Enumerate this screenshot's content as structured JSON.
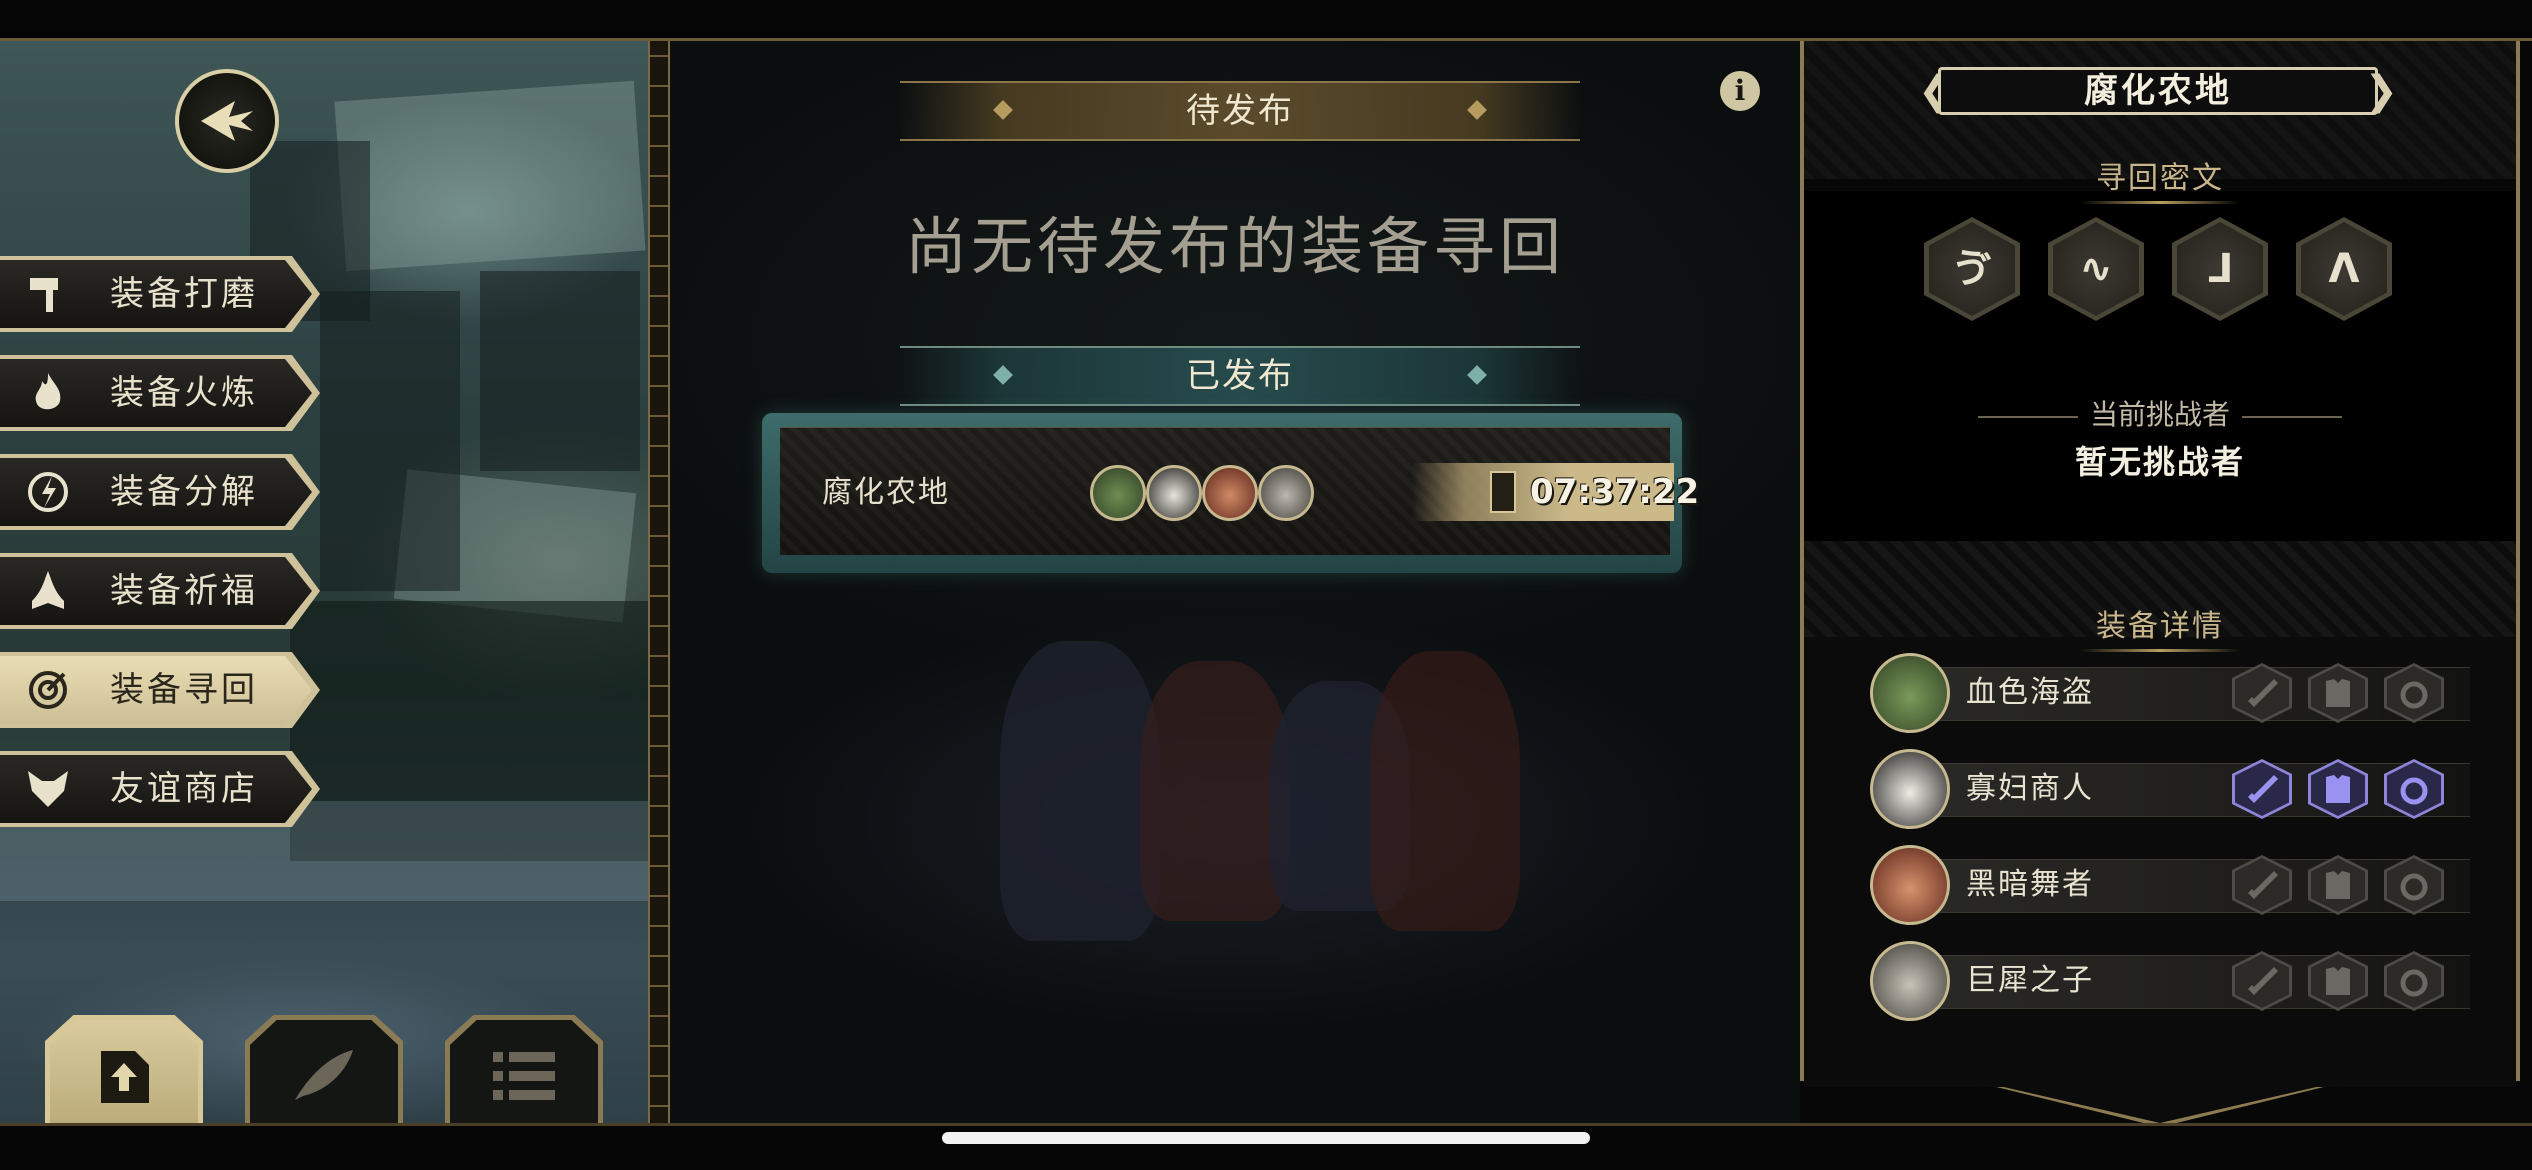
{
  "left_menu": {
    "items": [
      {
        "label": "装备打磨",
        "icon": "hammer-icon",
        "active": false
      },
      {
        "label": "装备火炼",
        "icon": "flame-icon",
        "active": false
      },
      {
        "label": "装备分解",
        "icon": "disassemble-icon",
        "active": false
      },
      {
        "label": "装备祈福",
        "icon": "praying-hands-icon",
        "active": false
      },
      {
        "label": "装备寻回",
        "icon": "target-icon",
        "active": true
      },
      {
        "label": "友谊商店",
        "icon": "fox-head-icon",
        "active": false
      }
    ],
    "bottom_tabs": [
      {
        "icon": "upload-document-icon",
        "active": true
      },
      {
        "icon": "feather-icon",
        "active": false
      },
      {
        "icon": "list-icon",
        "active": false
      }
    ]
  },
  "center": {
    "pending_header": "待发布",
    "empty_message": "尚无待发布的装备寻回",
    "published_header": "已发布",
    "published_missions": [
      {
        "name": "腐化农地",
        "timer": "07:37:22"
      }
    ]
  },
  "right_panel": {
    "location_title": "腐化农地",
    "cipher_title": "寻回密文",
    "cipher_glyphs": [
      "ゔ",
      "∿",
      "⅃",
      "ᐱ"
    ],
    "challenger_label": "当前挑战者",
    "challenger_value": "暂无挑战者",
    "equipment_title": "装备详情",
    "heroes": [
      {
        "name": "血色海盗",
        "slots_filled": [
          false,
          false,
          false
        ]
      },
      {
        "name": "寡妇商人",
        "slots_filled": [
          true,
          true,
          true
        ]
      },
      {
        "name": "黑暗舞者",
        "slots_filled": [
          false,
          false,
          false
        ]
      },
      {
        "name": "巨犀之子",
        "slots_filled": [
          false,
          false,
          false
        ]
      }
    ]
  },
  "colors": {
    "gold": "#c8b68a",
    "teal": "#3d6c6a",
    "equipped_purple": "#8d86d8"
  }
}
